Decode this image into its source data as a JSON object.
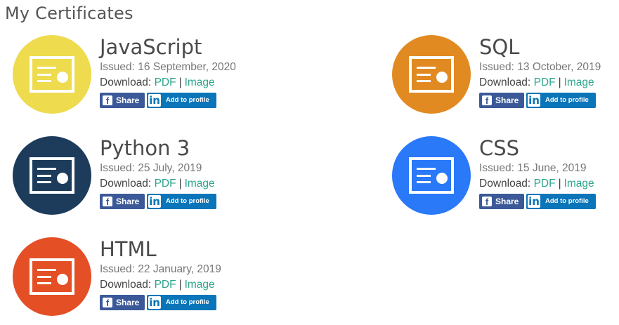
{
  "page": {
    "title": "My Certificates"
  },
  "download_label": "Download:",
  "certificates": [
    {
      "name": "JavaScript",
      "issued": "Issued: 16 September, 2020",
      "pdf": "PDF",
      "image": "Image",
      "share": "Share",
      "add_to_profile": "Add to profile",
      "color": "#eedb4e"
    },
    {
      "name": "SQL",
      "issued": "Issued: 13 October, 2019",
      "pdf": "PDF",
      "image": "Image",
      "share": "Share",
      "add_to_profile": "Add to profile",
      "color": "#e28a22"
    },
    {
      "name": "Python 3",
      "issued": "Issued: 25 July, 2019",
      "pdf": "PDF",
      "image": "Image",
      "share": "Share",
      "add_to_profile": "Add to profile",
      "color": "#1d3c5c"
    },
    {
      "name": "CSS",
      "issued": "Issued: 15 June, 2019",
      "pdf": "PDF",
      "image": "Image",
      "share": "Share",
      "add_to_profile": "Add to profile",
      "color": "#2979f8"
    },
    {
      "name": "HTML",
      "issued": "Issued: 22 January, 2019",
      "pdf": "PDF",
      "image": "Image",
      "share": "Share",
      "add_to_profile": "Add to profile",
      "color": "#e44f25"
    }
  ],
  "icons": {
    "badge": "certificate-icon",
    "facebook": "facebook-icon",
    "linkedin": "linkedin-icon"
  }
}
